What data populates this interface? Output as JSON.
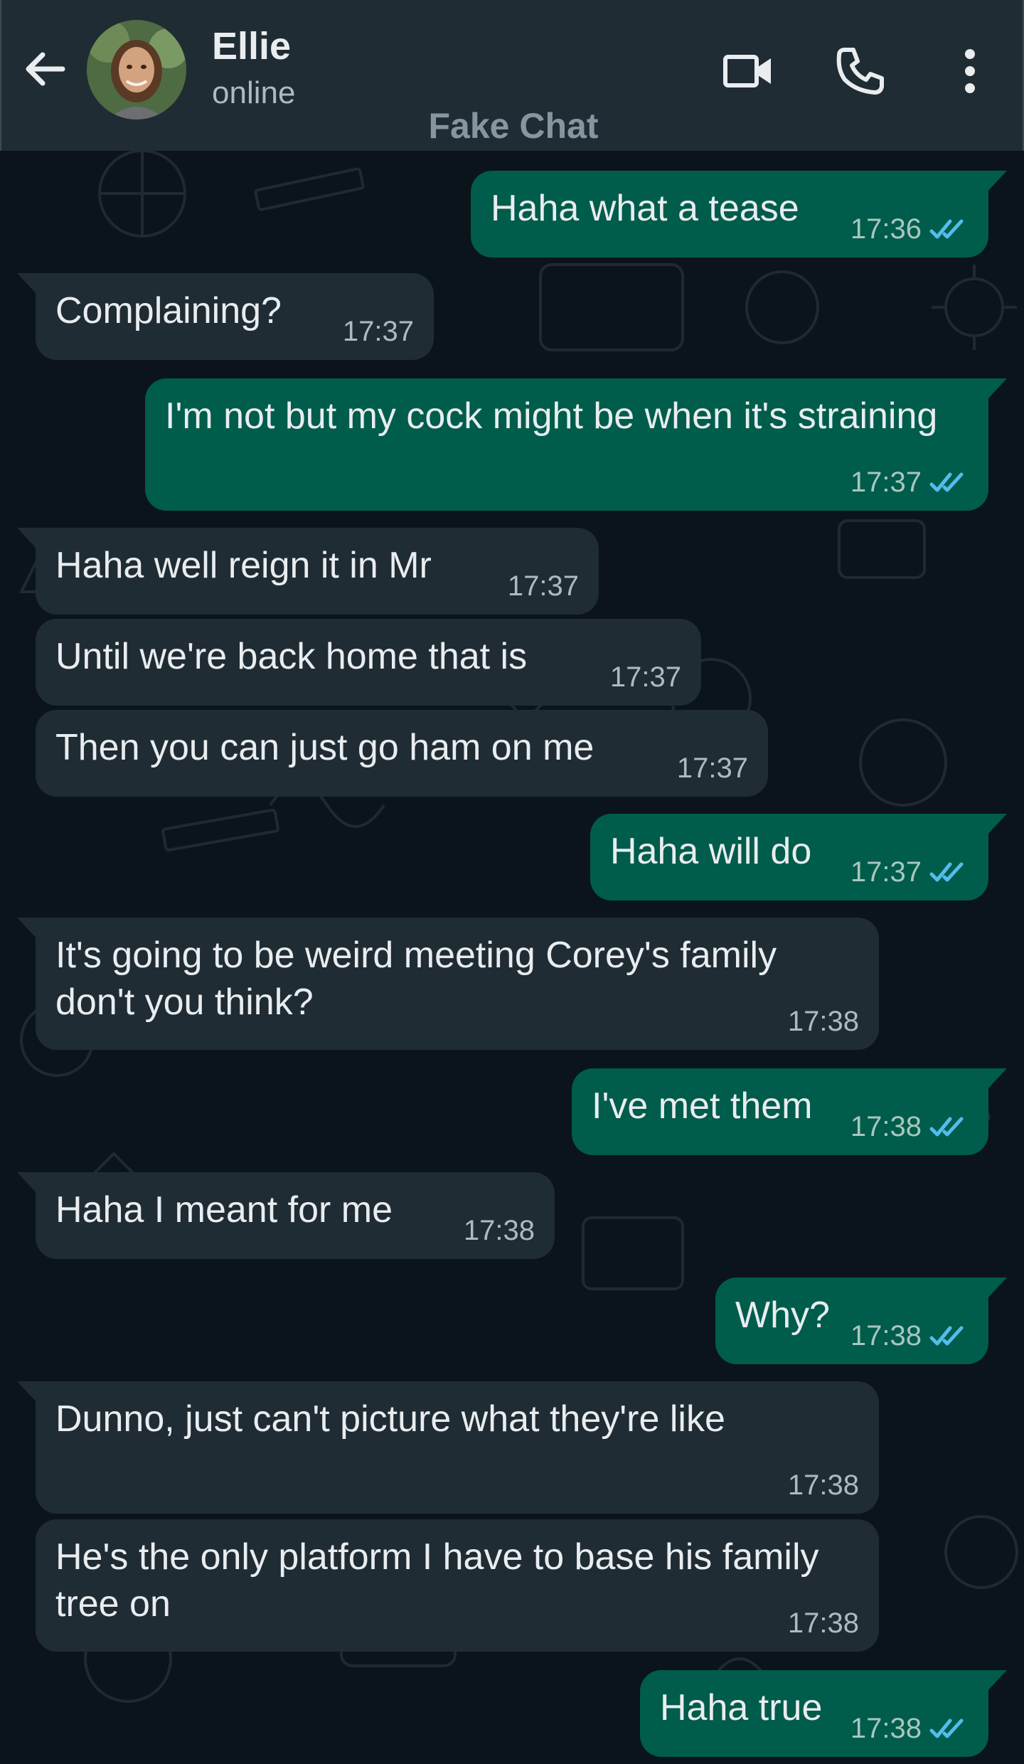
{
  "header": {
    "contact_name": "Ellie",
    "contact_status": "online",
    "watermark": "Fake Chat",
    "icons": [
      "back-arrow-icon",
      "video-call-icon",
      "voice-call-icon",
      "more-options-icon"
    ]
  },
  "colors": {
    "header_bg": "#202c33",
    "chat_bg": "#0b141a",
    "incoming_bubble": "#202c33",
    "outgoing_bubble": "#005c4b",
    "read_tick": "#53bdeb"
  },
  "messages": [
    {
      "dir": "out",
      "text": "Haha what a tease",
      "time": "17:36",
      "status": "read"
    },
    {
      "dir": "in",
      "text": "Complaining?",
      "time": "17:37"
    },
    {
      "dir": "out",
      "text": "I'm not but my cock might be when it's straining",
      "time": "17:37",
      "status": "read"
    },
    {
      "dir": "in",
      "text": "Haha well reign it in Mr",
      "time": "17:37"
    },
    {
      "dir": "in",
      "text": "Until we're back home that is",
      "time": "17:37"
    },
    {
      "dir": "in",
      "text": "Then you can just go ham on me",
      "time": "17:37"
    },
    {
      "dir": "out",
      "text": "Haha will do",
      "time": "17:37",
      "status": "read"
    },
    {
      "dir": "in",
      "text": "It's going to be weird meeting Corey's family don't you think?",
      "time": "17:38"
    },
    {
      "dir": "out",
      "text": "I've met them",
      "time": "17:38",
      "status": "read"
    },
    {
      "dir": "in",
      "text": "Haha I meant for me",
      "time": "17:38"
    },
    {
      "dir": "out",
      "text": "Why?",
      "time": "17:38",
      "status": "read"
    },
    {
      "dir": "in",
      "text": "Dunno, just can't picture what they're like",
      "time": "17:38"
    },
    {
      "dir": "in",
      "text": "He's the only platform I have to base his family tree on",
      "time": "17:38"
    },
    {
      "dir": "out",
      "text": "Haha true",
      "time": "17:38",
      "status": "read"
    }
  ]
}
